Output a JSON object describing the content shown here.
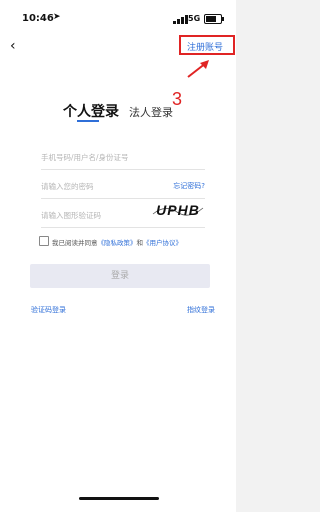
{
  "status_bar": {
    "time": "10:46",
    "location_glyph": "➤",
    "network": "5G",
    "signal_level": 1.0,
    "battery_level": 0.85
  },
  "header": {
    "back_glyph": "‹",
    "register_label": "注册账号"
  },
  "annotation": {
    "step_number": "3",
    "color": "#e02424"
  },
  "tabs": {
    "personal_label": "个人登录",
    "corporate_label": "法人登录",
    "active": "personal"
  },
  "form": {
    "username_placeholder": "手机号码/用户名/身份证号",
    "password_placeholder": "请输入您的密码",
    "forgot_password_label": "忘记密码?",
    "captcha_placeholder": "请输入图形验证码",
    "captcha_text": "UPHB"
  },
  "agreement": {
    "prefix": "我已阅读并同意",
    "privacy_link": "《隐私政策》",
    "conjunction": "和",
    "user_agreement_link": "《用户协议》"
  },
  "actions": {
    "login_label": "登录",
    "sms_login_label": "验证码登录",
    "fingerprint_login_label": "指纹登录"
  },
  "colors": {
    "accent": "#2f6fd8",
    "button_bg": "#e8e9f2",
    "highlight": "#e02424"
  }
}
